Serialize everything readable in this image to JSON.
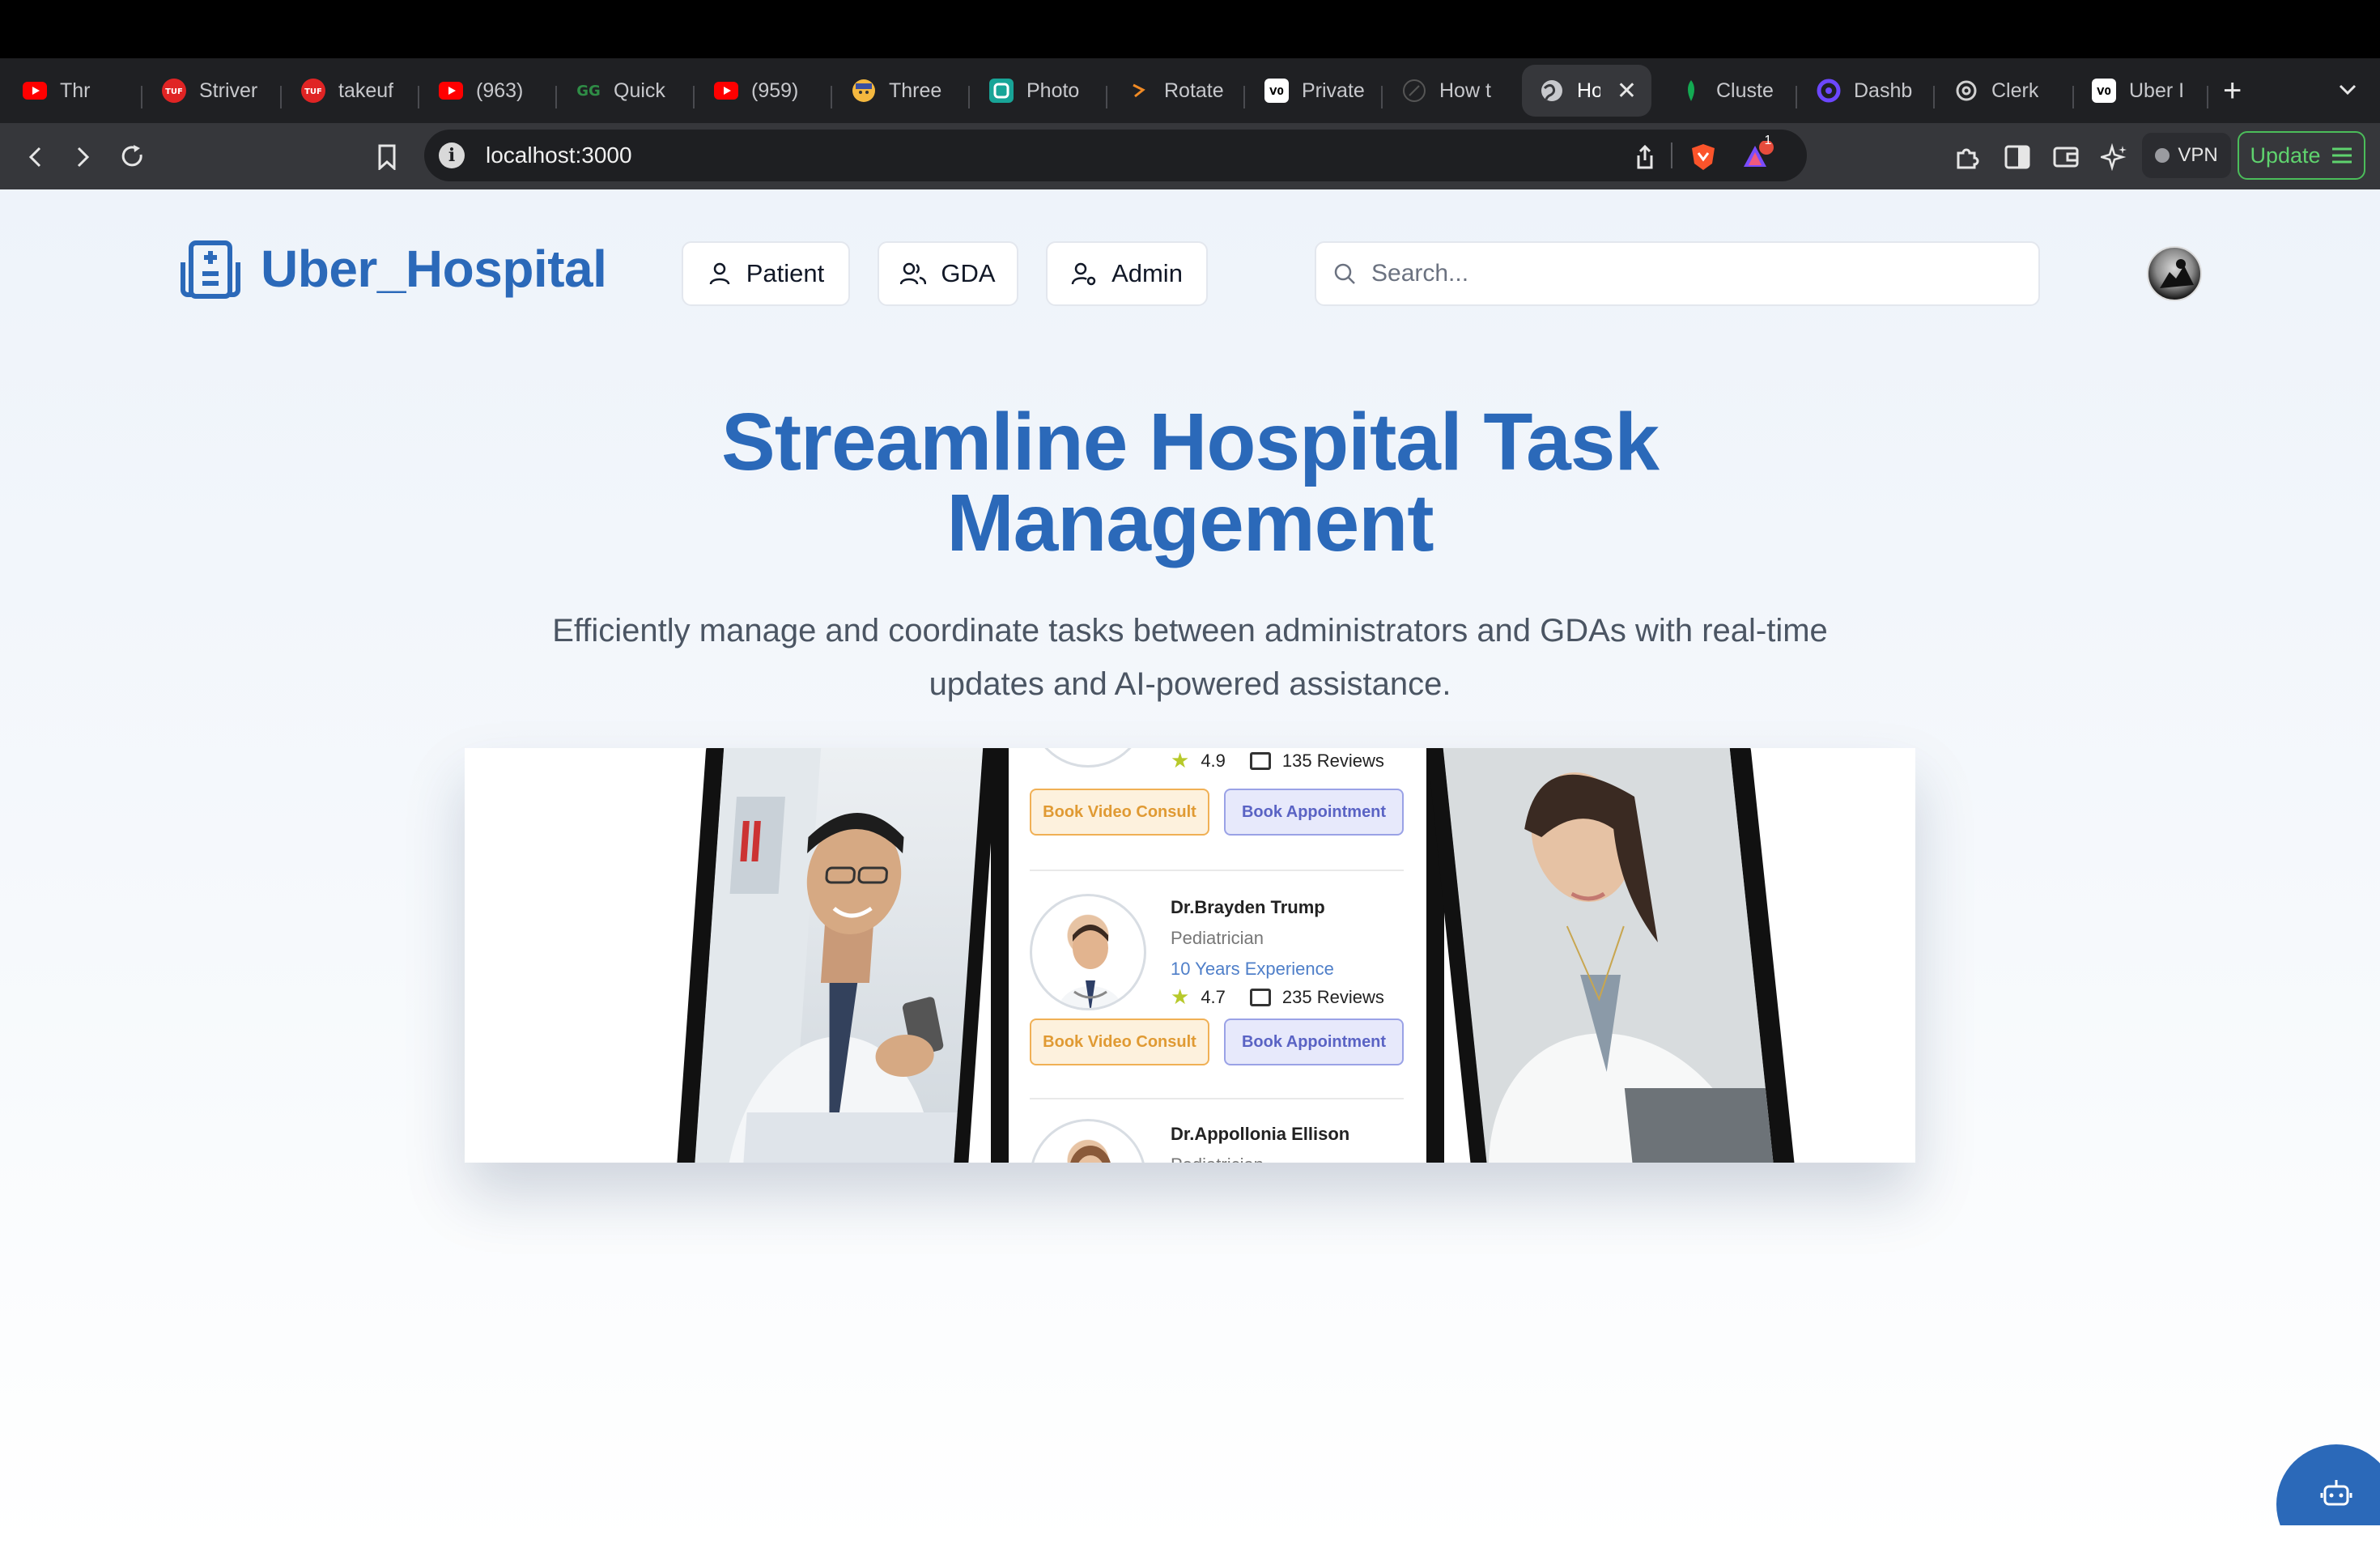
{
  "browser": {
    "tabs": [
      {
        "title": "Thr",
        "icon": "youtube-icon"
      },
      {
        "title": "Striver",
        "icon": "tuf-icon"
      },
      {
        "title": "takeuf",
        "icon": "tuf-icon"
      },
      {
        "title": "(963)",
        "icon": "youtube-icon"
      },
      {
        "title": "Quick",
        "icon": "geeksforgeeks-icon"
      },
      {
        "title": "(959)",
        "icon": "youtube-icon"
      },
      {
        "title": "Three",
        "icon": "emoji-icon"
      },
      {
        "title": "Photo",
        "icon": "photopea-icon"
      },
      {
        "title": "Rotate",
        "icon": "rotate-icon"
      },
      {
        "title": "Private",
        "icon": "vercel-icon"
      },
      {
        "title": "How t",
        "icon": "blank-icon"
      },
      {
        "title": "Ho",
        "icon": "globe-icon",
        "active": true
      },
      {
        "title": "Cluste",
        "icon": "mongodb-icon"
      },
      {
        "title": "Dashb",
        "icon": "clerk-icon"
      },
      {
        "title": "Clerk",
        "icon": "openai-icon"
      },
      {
        "title": "Uber I",
        "icon": "vercel-icon"
      }
    ],
    "url": "localhost:3000",
    "vpn_label": "VPN",
    "update_label": "Update",
    "notification_count": "1"
  },
  "header": {
    "brand": "Uber_Hospital",
    "nav": [
      {
        "label": "Patient",
        "icon": "user-icon"
      },
      {
        "label": "GDA",
        "icon": "users-icon"
      },
      {
        "label": "Admin",
        "icon": "user-cog-icon"
      }
    ],
    "search_placeholder": "Search..."
  },
  "hero": {
    "title_line1": "Streamline Hospital Task",
    "title_line2": "Management",
    "subtitle_line1": "Efficiently manage and coordinate tasks between administrators and GDAs with real-time",
    "subtitle_line2": "updates and AI-powered assistance."
  },
  "hero_image": {
    "top_rating": "4.9",
    "top_reviews": "135 Reviews",
    "btn_video": "Book Video Consult",
    "btn_appointment": "Book Appointment",
    "doctors": [
      {
        "name": "Dr.Brayden Trump",
        "specialty": "Pediatrician",
        "experience": "10 Years Experience",
        "rating": "4.7",
        "reviews": "235 Reviews"
      },
      {
        "name": "Dr.Appollonia Ellison",
        "specialty": "Pediatrician"
      }
    ]
  },
  "colors": {
    "brand_blue": "#2b69b9",
    "chatbot_blue": "#2b69b9",
    "update_green": "#5fd36e"
  }
}
